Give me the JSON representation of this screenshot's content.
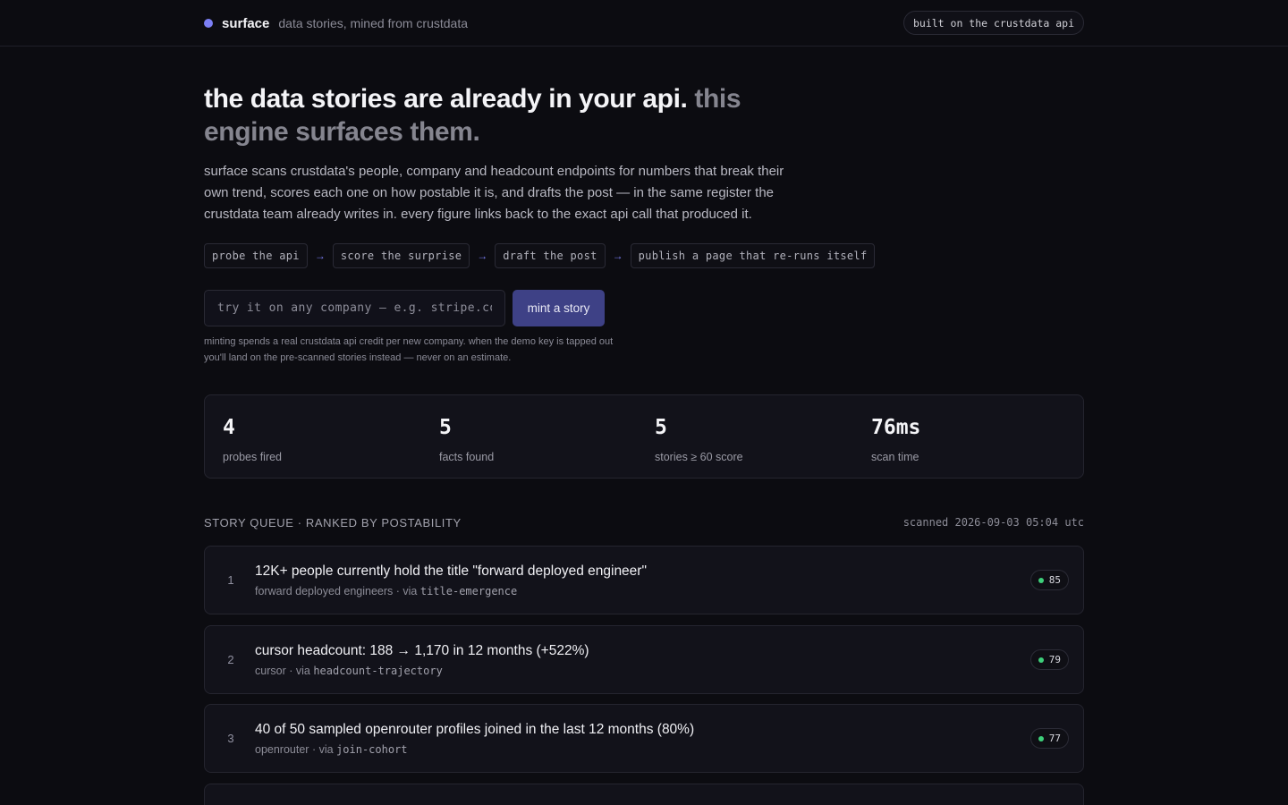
{
  "header": {
    "brand_name": "surface",
    "brand_tagline": "data stories, mined from crustdata",
    "api_badge": "built on the crustdata api",
    "accent_color": "#7c7ff5"
  },
  "hero": {
    "headline_primary": "the data stories are already in your api.",
    "headline_secondary": "this engine surfaces them.",
    "intro": "surface scans crustdata's people, company and headcount endpoints for numbers that break their own trend, scores each one on how postable it is, and drafts the post — in the same register the crustdata team already writes in. every figure links back to the exact api call that produced it."
  },
  "pipeline": {
    "steps": [
      "probe the api",
      "score the surprise",
      "draft the post",
      "publish a page that re-runs itself"
    ],
    "separator": "→"
  },
  "mint": {
    "placeholder": "try it on any company — e.g. stripe.com",
    "value": "",
    "button_label": "mint a story",
    "note": "minting spends a real crustdata api credit per new company. when the demo key is tapped out you'll land on the pre-scanned stories instead — never on an estimate."
  },
  "stats": [
    {
      "value": "4",
      "label": "probes fired"
    },
    {
      "value": "5",
      "label": "facts found"
    },
    {
      "value": "5",
      "label": "stories ≥ 60 score"
    },
    {
      "value": "76ms",
      "label": "scan time"
    }
  ],
  "queue": {
    "title": "STORY QUEUE · RANKED BY POSTABILITY",
    "scanned": "scanned 2026-09-03 05:04 utc",
    "via_label": "via",
    "score_color": "#3ecf7a",
    "stories": [
      {
        "rank": "1",
        "title": "12K+ people currently hold the title \"forward deployed engineer\"",
        "source": "forward deployed engineers",
        "probe": "title-emergence",
        "score": "85"
      },
      {
        "rank": "2",
        "title": "cursor headcount: 188 → 1,170 in 12 months (+522%)",
        "source": "cursor",
        "probe": "headcount-trajectory",
        "score": "79"
      },
      {
        "rank": "3",
        "title": "40 of 50 sampled openrouter profiles joined in the last 12 months (80%)",
        "source": "openrouter",
        "probe": "join-cohort",
        "score": "77"
      }
    ]
  }
}
